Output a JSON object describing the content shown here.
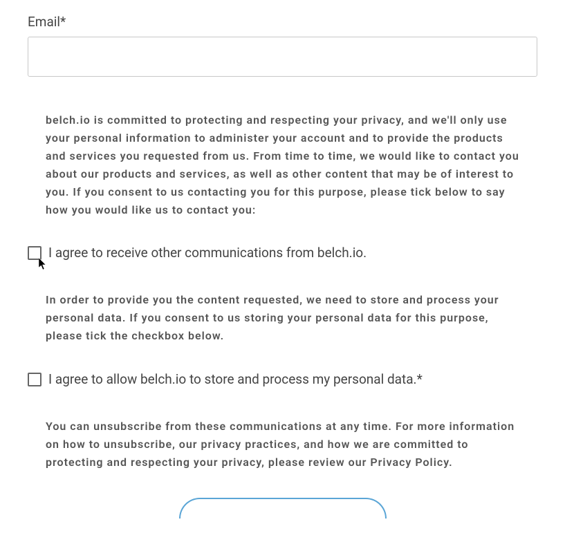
{
  "email": {
    "label": "Email*",
    "value": ""
  },
  "privacy_intro": "belch.io is committed to protecting and respecting your privacy, and we'll only use your personal information to administer your account and to provide the products and services you requested from us. From time to time, we would like to contact you about our products and services, as well as other content that may be of interest to you. If you consent to us contacting you for this purpose, please tick below to say how you would like us to contact you:",
  "consent_communications": {
    "label": "I agree to receive other communications from belch.io.",
    "checked": false
  },
  "storage_text": "In order to provide you the content requested, we need to store and process your personal data. If you consent to us storing your personal data for this purpose, please tick the checkbox below.",
  "consent_storage": {
    "label": "I agree to allow belch.io to store and process my personal data.*",
    "checked": false
  },
  "unsubscribe_text": "You can unsubscribe from these communications at any time. For more information on how to unsubscribe, our privacy practices, and how we are committed to protecting and respecting your privacy, please review our Privacy Policy."
}
